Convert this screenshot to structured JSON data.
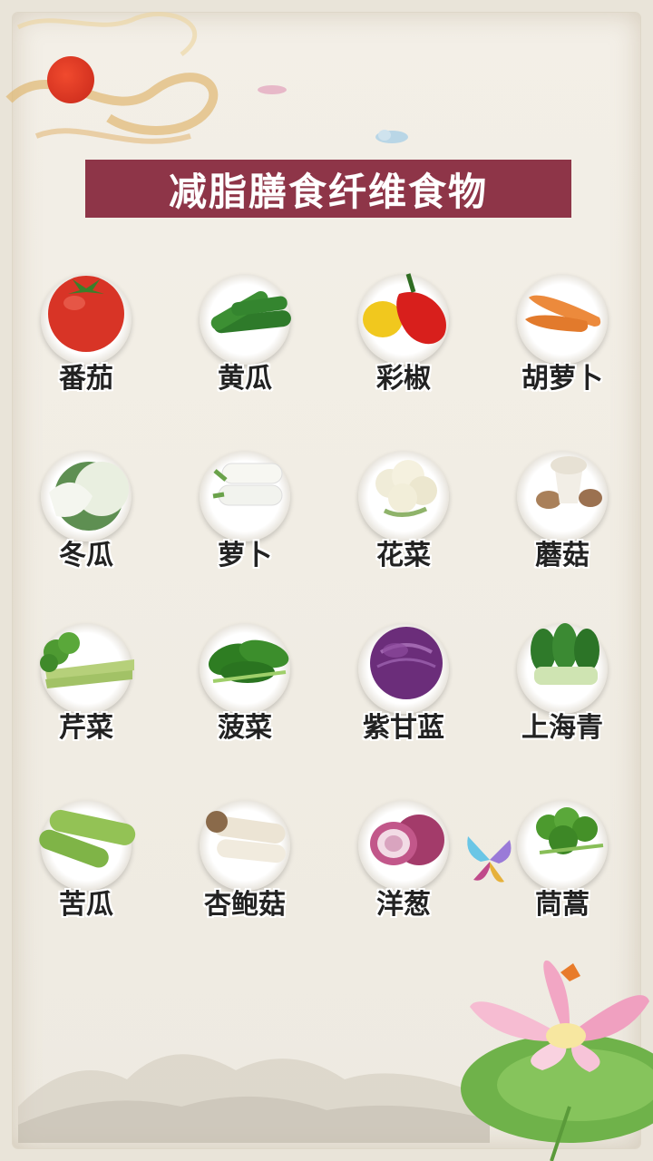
{
  "title": "减脂膳食纤维食物",
  "foods": [
    {
      "name": "番茄",
      "icon": "tomato-icon"
    },
    {
      "name": "黄瓜",
      "icon": "cucumber-icon"
    },
    {
      "name": "彩椒",
      "icon": "bell-pepper-icon"
    },
    {
      "name": "胡萝卜",
      "icon": "carrot-icon"
    },
    {
      "name": "冬瓜",
      "icon": "winter-melon-icon"
    },
    {
      "name": "萝卜",
      "icon": "radish-icon"
    },
    {
      "name": "花菜",
      "icon": "cauliflower-icon"
    },
    {
      "name": "蘑菇",
      "icon": "mushroom-icon"
    },
    {
      "name": "芹菜",
      "icon": "celery-icon"
    },
    {
      "name": "菠菜",
      "icon": "spinach-icon"
    },
    {
      "name": "紫甘蓝",
      "icon": "red-cabbage-icon"
    },
    {
      "name": "上海青",
      "icon": "bok-choy-icon"
    },
    {
      "name": "苦瓜",
      "icon": "bitter-melon-icon"
    },
    {
      "name": "杏鲍菇",
      "icon": "king-oyster-mushroom-icon"
    },
    {
      "name": "洋葱",
      "icon": "onion-icon"
    },
    {
      "name": "茼蒿",
      "icon": "crown-daisy-icon"
    }
  ],
  "colors": {
    "title_bg": "#8e3548",
    "title_text": "#ffffff",
    "paper": "#f1ede4"
  }
}
